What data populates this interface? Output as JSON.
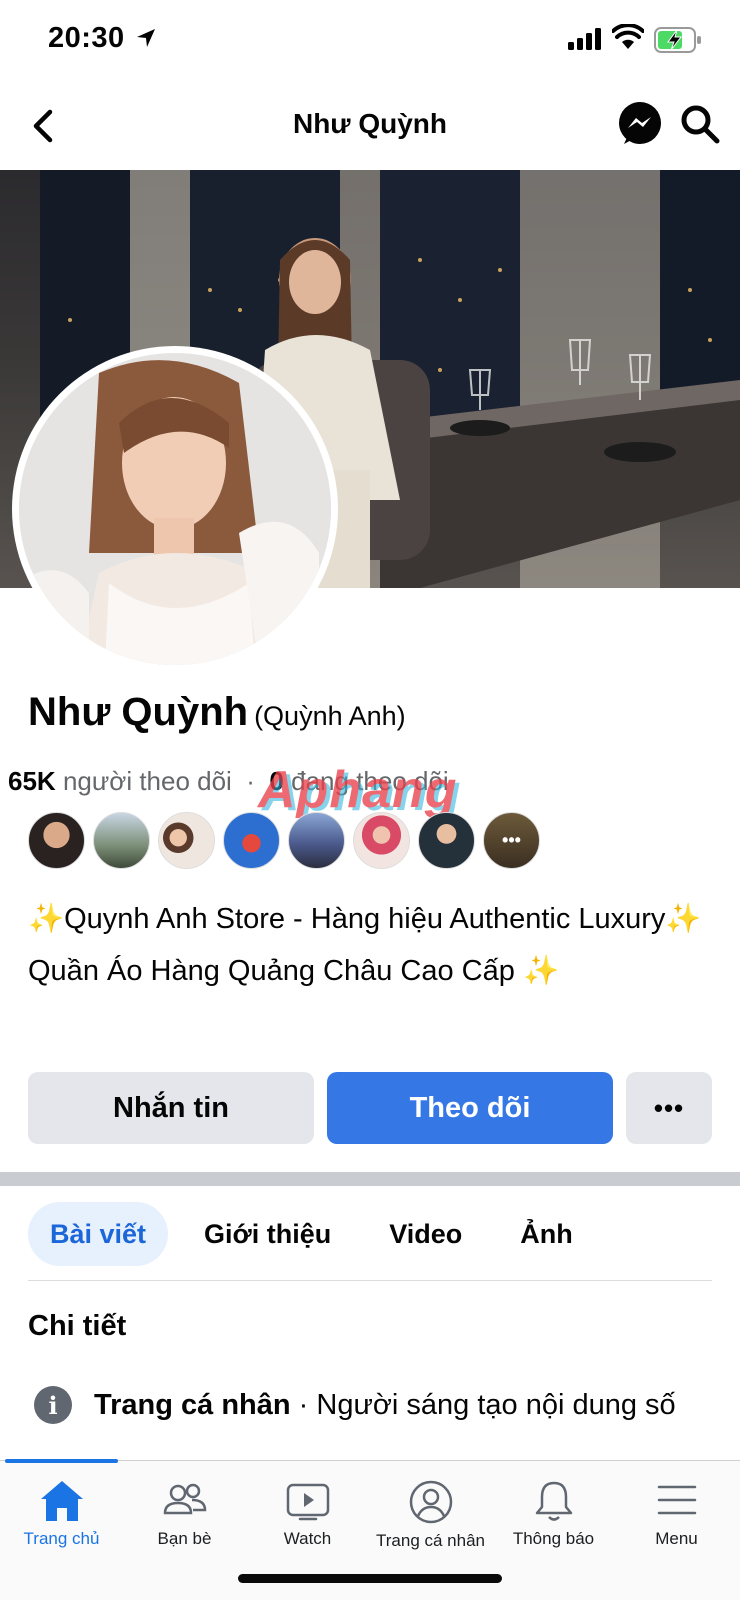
{
  "status_bar": {
    "time": "20:30"
  },
  "header": {
    "title": "Như Quỳnh"
  },
  "profile": {
    "name": "Như Quỳnh",
    "alt_name": "(Quỳnh Anh)",
    "followers_count": "65K",
    "followers_label": "người theo dõi",
    "following_count": "0",
    "following_label": "đang theo dõi",
    "watermark": "Aphang",
    "bio": "✨Quynh Anh Store - Hàng hiệu Authentic Luxury✨ Quần Áo Hàng Quảng Châu Cao Cấp ✨",
    "more_friends_label": "•••"
  },
  "actions": {
    "message": "Nhắn tin",
    "follow": "Theo dõi",
    "more": "•••"
  },
  "tabs": [
    {
      "label": "Bài viết",
      "active": true
    },
    {
      "label": "Giới thiệu",
      "active": false
    },
    {
      "label": "Video",
      "active": false
    },
    {
      "label": "Ảnh",
      "active": false
    }
  ],
  "details": {
    "title": "Chi tiết",
    "icon_glyph": "i",
    "item_bold": "Trang cá nhân",
    "item_sep": " · ",
    "item_value": "Người sáng tạo nội dung số"
  },
  "bottom_nav": [
    {
      "label": "Trang chủ",
      "icon": "home-icon",
      "active": true
    },
    {
      "label": "Bạn bè",
      "icon": "friends-icon",
      "active": false
    },
    {
      "label": "Watch",
      "icon": "watch-icon",
      "active": false
    },
    {
      "label": "Trang cá nhân",
      "icon": "profile-icon",
      "active": false
    },
    {
      "label": "Thông báo",
      "icon": "bell-icon",
      "active": false
    },
    {
      "label": "Menu",
      "icon": "menu-icon",
      "active": false
    }
  ],
  "colors": {
    "accent": "#1b74e4",
    "follow_button": "#3578e5",
    "tab_active_bg": "#e7f0fd"
  }
}
